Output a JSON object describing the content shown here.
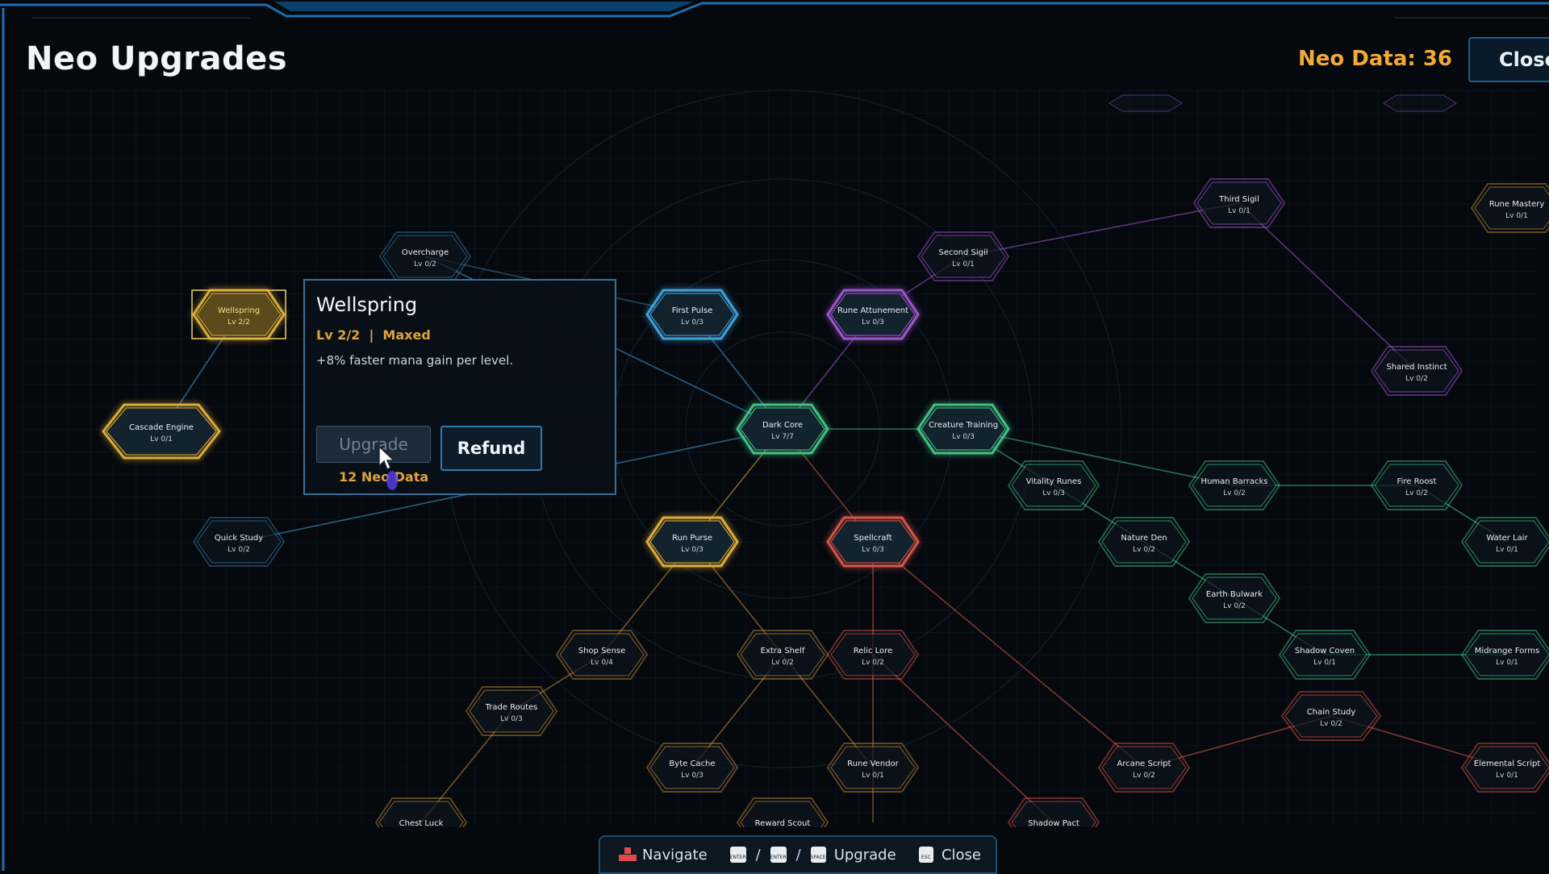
{
  "header": {
    "title": "Neo Upgrades",
    "neo_data": "Neo Data: 36",
    "close_label": "Close"
  },
  "tooltip": {
    "name": "Wellspring",
    "level_status": "Lv 2/2  |  Maxed",
    "description": "+8% faster mana gain per level.",
    "upgrade_label": "Upgrade",
    "refund_label": "Refund",
    "cost": "12 Neo Data"
  },
  "bottom_hints": {
    "navigate": "Navigate",
    "key_enter": "ENTER",
    "key_space": "SPACE",
    "key_esc": "ESC",
    "upgrade": "Upgrade",
    "close": "Close",
    "separator": "/"
  },
  "colors": {
    "blue": "#45a8e6",
    "gold": "#e6b53c",
    "green": "#46c98a",
    "purple": "#a45bd6",
    "red": "#e05a4f",
    "teal": "#3a7fa6",
    "orange": "#c9923d"
  },
  "nodes": [
    {
      "id": "wellspring",
      "name": "Wellspring",
      "level": "Lv 2/2",
      "color": "gold",
      "state": "selected"
    },
    {
      "id": "cascade",
      "name": "Cascade Engine",
      "level": "Lv 0/1",
      "color": "gold",
      "state": "available"
    },
    {
      "id": "overcharge",
      "name": "Overcharge",
      "level": "Lv 0/2",
      "color": "teal",
      "state": "locked"
    },
    {
      "id": "quickstudy",
      "name": "Quick Study",
      "level": "Lv 0/2",
      "color": "teal",
      "state": "locked"
    },
    {
      "id": "firstpulse",
      "name": "First Pulse",
      "level": "Lv 0/3",
      "color": "blue",
      "state": "available"
    },
    {
      "id": "darkcore",
      "name": "Dark Core",
      "level": "Lv 7/7",
      "color": "green",
      "state": "maxed"
    },
    {
      "id": "runeattune",
      "name": "Rune Attunement",
      "level": "Lv 0/3",
      "color": "purple",
      "state": "available"
    },
    {
      "id": "secondsigil",
      "name": "Second Sigil",
      "level": "Lv 0/1",
      "color": "purple",
      "state": "locked"
    },
    {
      "id": "thirdsigil",
      "name": "Third Sigil",
      "level": "Lv 0/1",
      "color": "purple",
      "state": "locked"
    },
    {
      "id": "runemastery",
      "name": "Rune Mastery",
      "level": "Lv 0/1",
      "color": "orange",
      "state": "locked"
    },
    {
      "id": "sharedinstinct",
      "name": "Shared Instinct",
      "level": "Lv 0/2",
      "color": "purple",
      "state": "locked"
    },
    {
      "id": "creaturetraining",
      "name": "Creature Training",
      "level": "Lv 0/3",
      "color": "green",
      "state": "available"
    },
    {
      "id": "vitalityrunes",
      "name": "Vitality Runes",
      "level": "Lv 0/3",
      "color": "green",
      "state": "locked"
    },
    {
      "id": "humanbarracks",
      "name": "Human Barracks",
      "level": "Lv 0/2",
      "color": "green",
      "state": "locked"
    },
    {
      "id": "fireroost",
      "name": "Fire Roost",
      "level": "Lv 0/2",
      "color": "green",
      "state": "locked"
    },
    {
      "id": "waterlair",
      "name": "Water Lair",
      "level": "Lv 0/1",
      "color": "green",
      "state": "locked"
    },
    {
      "id": "natureden",
      "name": "Nature Den",
      "level": "Lv 0/2",
      "color": "green",
      "state": "locked"
    },
    {
      "id": "earthbulwark",
      "name": "Earth Bulwark",
      "level": "Lv 0/2",
      "color": "green",
      "state": "locked"
    },
    {
      "id": "shadowcoven",
      "name": "Shadow Coven",
      "level": "Lv 0/1",
      "color": "green",
      "state": "locked"
    },
    {
      "id": "midrangeforms",
      "name": "Midrange Forms",
      "level": "Lv 0/1",
      "color": "green",
      "state": "locked"
    },
    {
      "id": "runpurse",
      "name": "Run Purse",
      "level": "Lv 0/3",
      "color": "gold",
      "state": "available"
    },
    {
      "id": "spellcraft",
      "name": "Spellcraft",
      "level": "Lv 0/3",
      "color": "red",
      "state": "available"
    },
    {
      "id": "shopsense",
      "name": "Shop Sense",
      "level": "Lv 0/4",
      "color": "orange",
      "state": "locked"
    },
    {
      "id": "extrashelf",
      "name": "Extra Shelf",
      "level": "Lv 0/2",
      "color": "orange",
      "state": "locked"
    },
    {
      "id": "relicore",
      "name": "Relic Lore",
      "level": "Lv 0/2",
      "color": "red",
      "state": "locked"
    },
    {
      "id": "traderoutes",
      "name": "Trade Routes",
      "level": "Lv 0/3",
      "color": "orange",
      "state": "locked"
    },
    {
      "id": "bytecache",
      "name": "Byte Cache",
      "level": "Lv 0/3",
      "color": "orange",
      "state": "locked"
    },
    {
      "id": "runevendor",
      "name": "Rune Vendor",
      "level": "Lv 0/1",
      "color": "orange",
      "state": "locked"
    },
    {
      "id": "chainstudy",
      "name": "Chain Study",
      "level": "Lv 0/2",
      "color": "red",
      "state": "locked"
    },
    {
      "id": "arcanescript",
      "name": "Arcane Script",
      "level": "Lv 0/2",
      "color": "red",
      "state": "locked"
    },
    {
      "id": "elementalscript",
      "name": "Elemental Script",
      "level": "Lv 0/1",
      "color": "red",
      "state": "locked"
    },
    {
      "id": "chestluck",
      "name": "Chest Luck",
      "level": "",
      "color": "orange",
      "state": "locked"
    },
    {
      "id": "rewardscout",
      "name": "Reward Scout",
      "level": "",
      "color": "orange",
      "state": "locked"
    },
    {
      "id": "shadowpact",
      "name": "Shadow Pact",
      "level": "",
      "color": "red",
      "state": "locked"
    }
  ]
}
